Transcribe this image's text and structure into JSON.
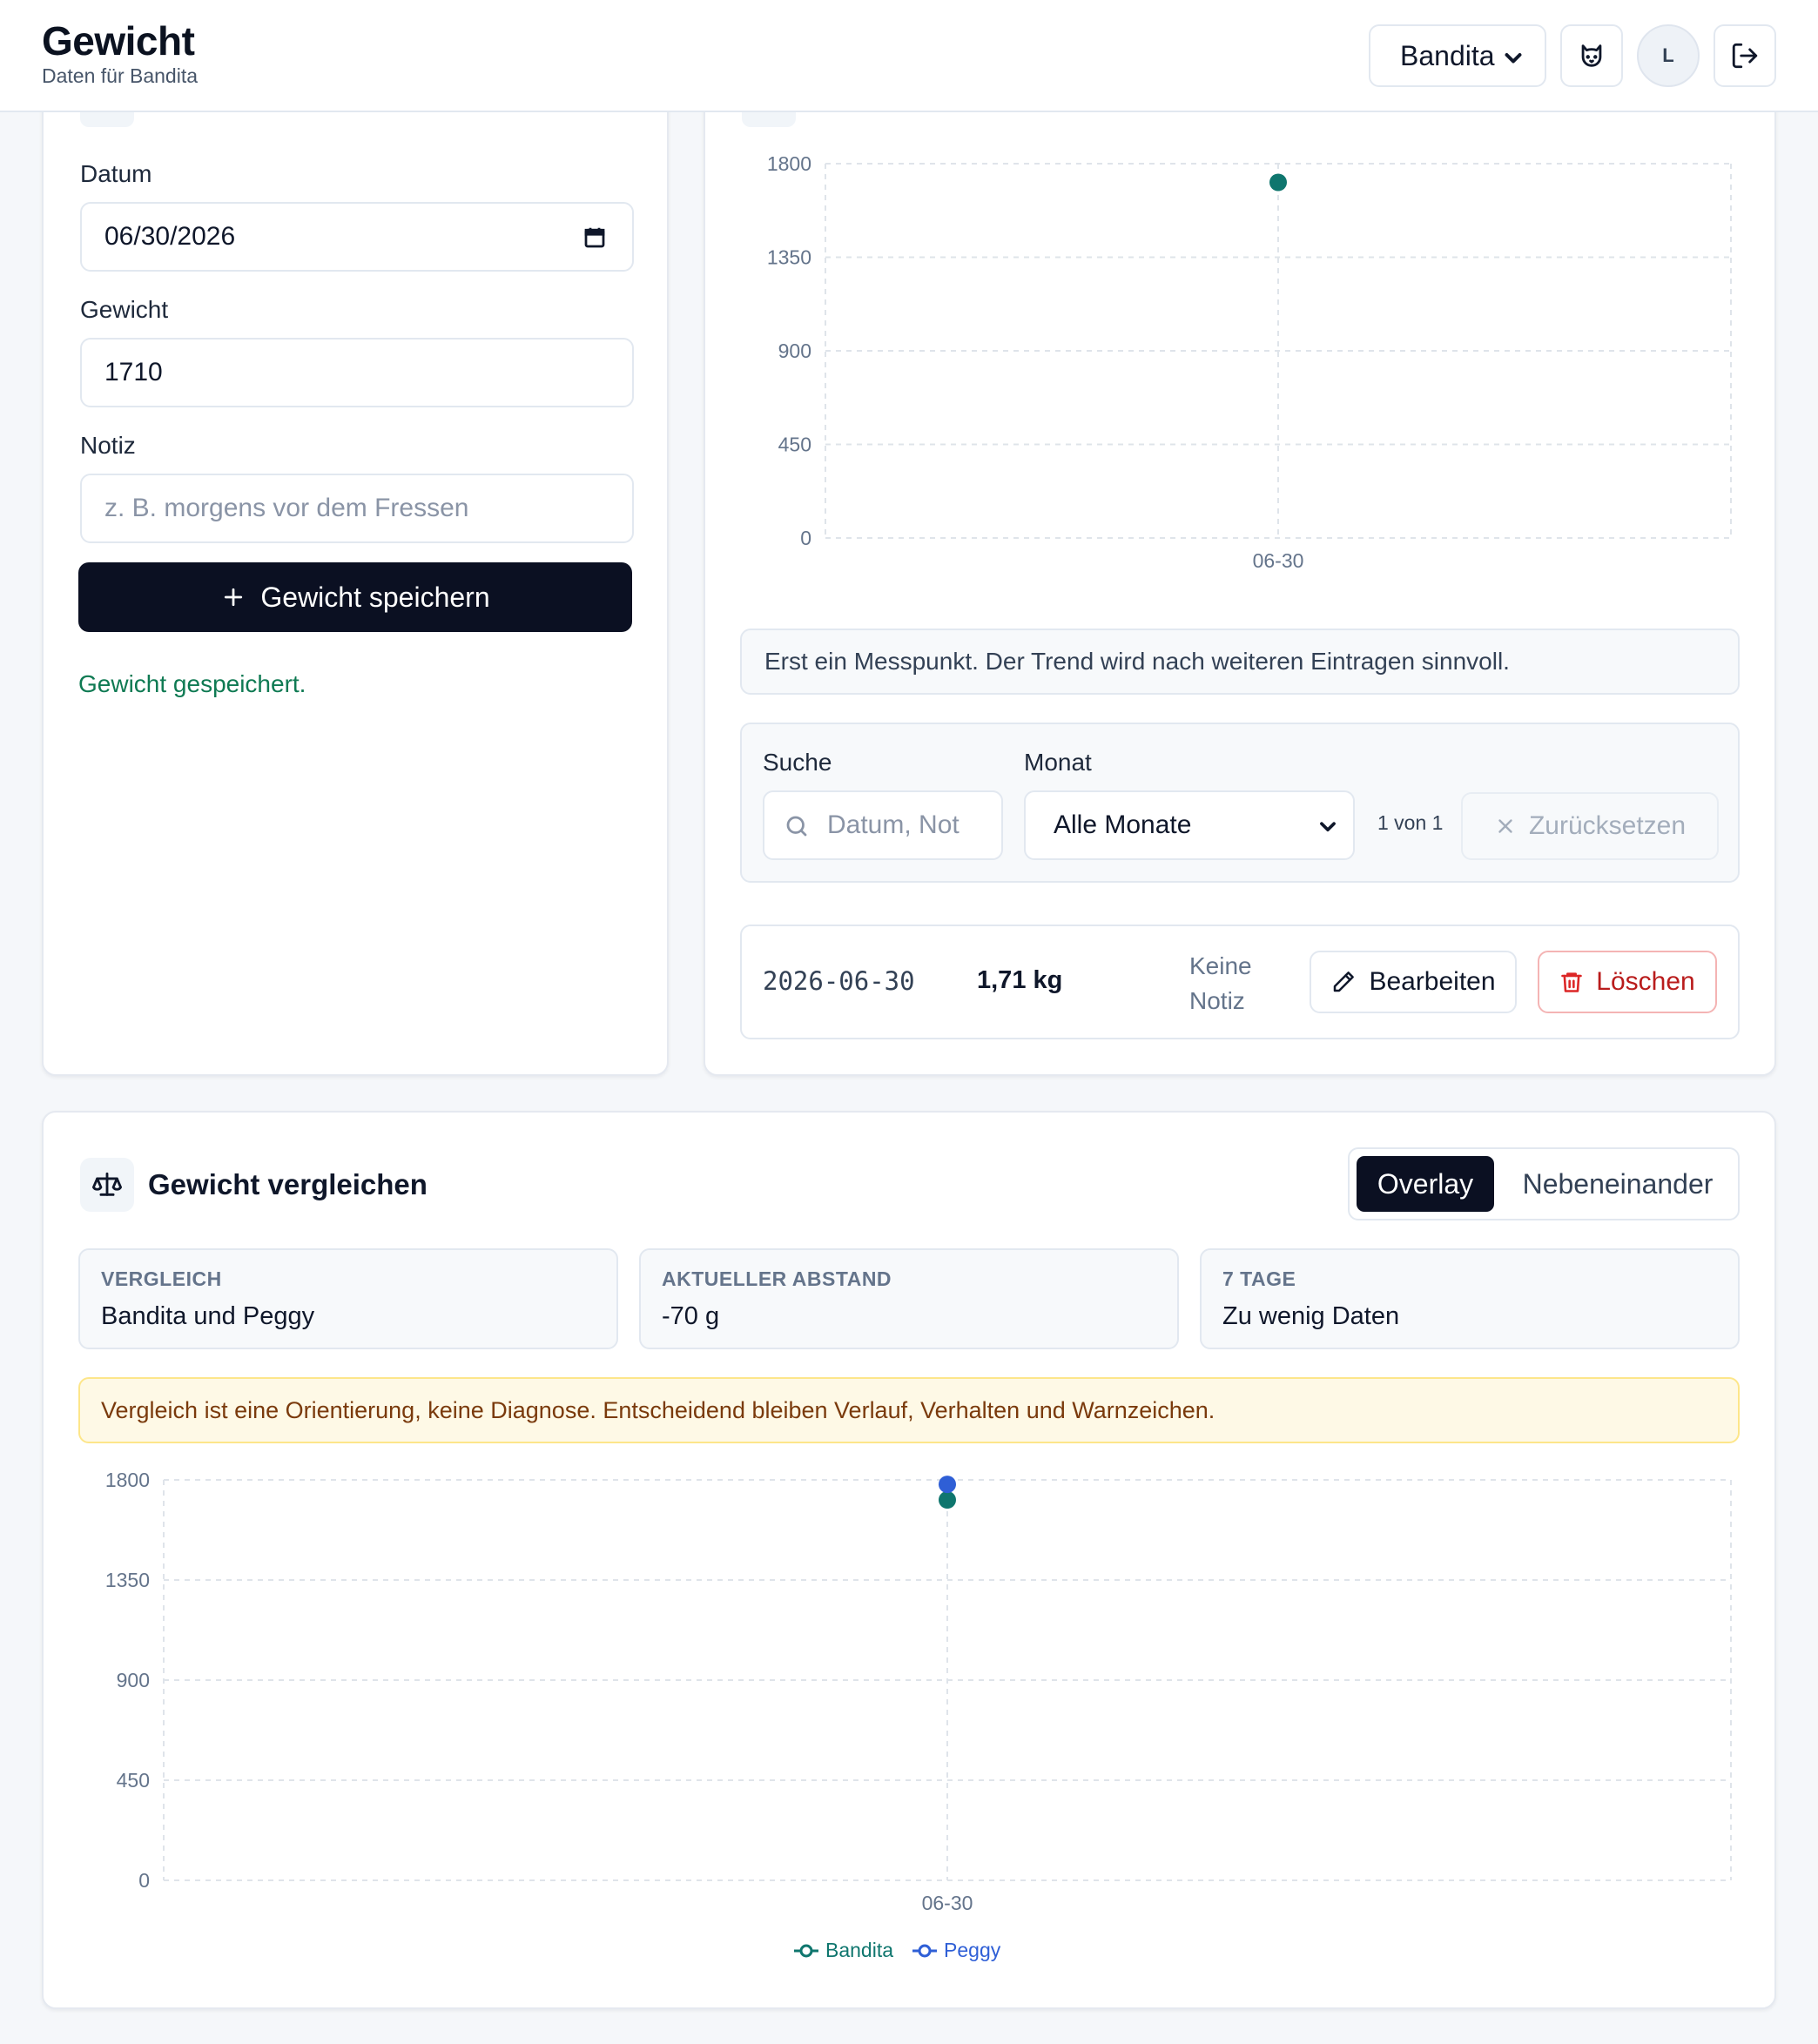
{
  "header": {
    "title": "Gewicht",
    "subtitle": "Daten für Bandita",
    "cat_selected": "Bandita",
    "icons": [
      "cat-icon",
      "logout-icon"
    ],
    "avatar_initial": "L"
  },
  "entry_form": {
    "date_label": "Datum",
    "date_value": "06/30/2026",
    "weight_label": "Gewicht",
    "weight_value": "1710",
    "note_label": "Notiz",
    "note_placeholder": "z. B. morgens vor dem Fressen",
    "save_label": "Gewicht speichern",
    "success_message": "Gewicht gespeichert."
  },
  "history": {
    "info_message": "Erst ein Messpunkt. Der Trend wird nach weiteren Eintragen sinnvoll.",
    "search_label": "Suche",
    "search_placeholder": "Datum, Not",
    "month_label": "Monat",
    "month_selected": "Alle Monate",
    "page_info": "1 von 1",
    "reset_label": "Zurücksetzen",
    "entries": [
      {
        "date": "2026-06-30",
        "weight": "1,71 kg",
        "note_line1": "Keine",
        "note_line2": "Notiz",
        "edit_label": "Bearbeiten",
        "delete_label": "Löschen"
      }
    ]
  },
  "compare": {
    "title": "Gewicht vergleichen",
    "mode_overlay": "Overlay",
    "mode_side": "Nebeneinander",
    "stats": [
      {
        "key": "VERGLEICH",
        "value": "Bandita und Peggy"
      },
      {
        "key": "AKTUELLER ABSTAND",
        "value": "-70 g"
      },
      {
        "key": "7 TAGE",
        "value": "Zu wenig Daten"
      }
    ],
    "warning": "Vergleich ist eine Orientierung, keine Diagnose. Entscheidend bleiben Verlauf, Verhalten und Warnzeichen."
  },
  "colors": {
    "bandita": "#0f766e",
    "peggy": "#2f5fd6",
    "primary": "#0b1022",
    "success": "#0f7a53",
    "danger": "#dc2626"
  },
  "chart_data": [
    {
      "type": "scatter",
      "categories": [
        "06-30"
      ],
      "series": [
        {
          "values": [
            1710
          ]
        }
      ],
      "yticks": [
        "0",
        "450",
        "900",
        "1350",
        "1800"
      ],
      "ylim": [
        0,
        1800
      ],
      "grid": true
    },
    {
      "type": "scatter",
      "categories": [
        "06-30"
      ],
      "series": [
        {
          "name": "Bandita",
          "values": [
            1710
          ]
        },
        {
          "name": "Peggy",
          "values": [
            1780
          ]
        }
      ],
      "yticks": [
        "0",
        "450",
        "900",
        "1350",
        "1800"
      ],
      "ylim": [
        0,
        1800
      ],
      "grid": true,
      "legend": "bottom-center"
    }
  ]
}
